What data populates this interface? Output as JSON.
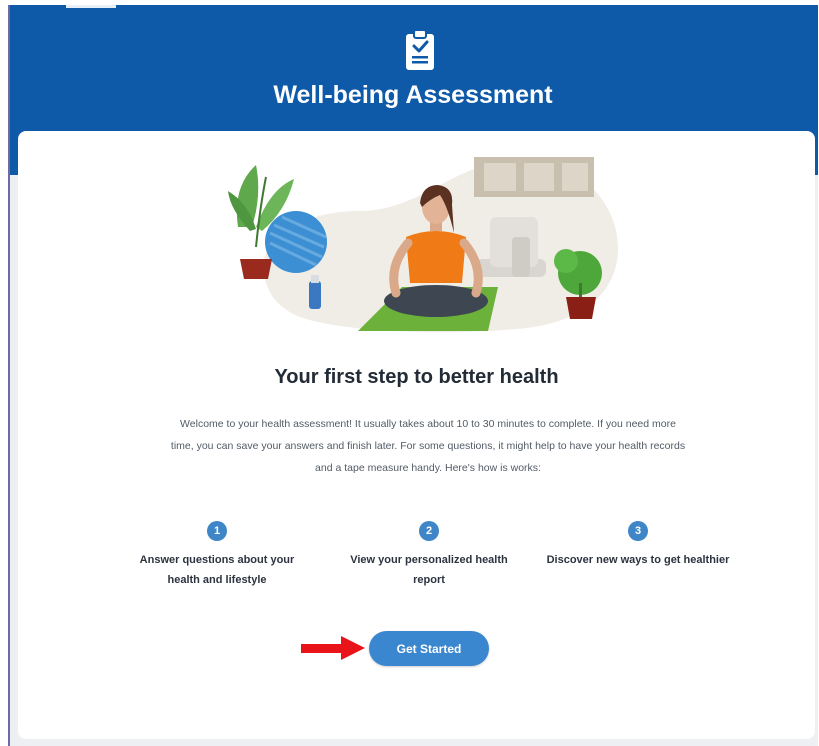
{
  "header": {
    "title": "Well-being Assessment",
    "icon": "clipboard-check-icon",
    "color": "#0f5aa8"
  },
  "main": {
    "headline": "Your first step to better health",
    "intro": "Welcome to your health assessment! It usually takes about 10 to 30 minutes to complete. If you need more time, you can save your answers and finish later. For some questions, it might help to have your health records and a tape measure handy. Here's how is works:",
    "steps": [
      {
        "number": "1",
        "text": "Answer questions about your health and lifestyle"
      },
      {
        "number": "2",
        "text": "View your personalized health report"
      },
      {
        "number": "3",
        "text": "Discover new ways to get healthier"
      }
    ],
    "cta_label": "Get Started",
    "cta_color": "#3b87cf",
    "annotation_arrow_color": "#e8141a"
  }
}
